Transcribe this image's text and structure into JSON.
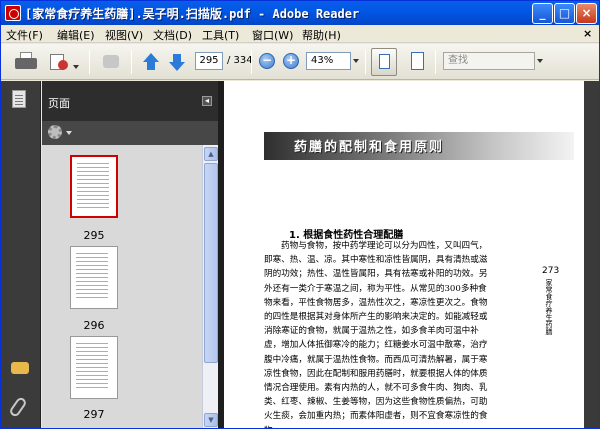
{
  "window": {
    "title": "[家常食疗养生药膳].吴子明.扫描版.pdf - Adobe Reader"
  },
  "menu": {
    "items": [
      "文件(F)",
      "编辑(E)",
      "视图(V)",
      "文档(D)",
      "工具(T)",
      "窗口(W)",
      "帮助(H)"
    ],
    "close_glyph": "×"
  },
  "toolbar": {
    "page_current": "295",
    "page_total": "/ 334",
    "zoom": "43%",
    "search_placeholder": "查找",
    "zoom_out_glyph": "−",
    "zoom_in_glyph": "+"
  },
  "window_buttons": {
    "minimize": "_",
    "maximize": "□",
    "close": "×"
  },
  "panel": {
    "title": "页面",
    "collapse_glyph": "◂",
    "thumbnails": [
      {
        "number": "295",
        "selected": true
      },
      {
        "number": "296",
        "selected": false
      },
      {
        "number": "297",
        "selected": false
      }
    ],
    "scroll_up": "▲",
    "scroll_down": "▼"
  },
  "document": {
    "heading": "药膳的配制和食用原则",
    "section_title": "1. 根据食性药性合理配膳",
    "side_page_number": "273",
    "side_caption": "家常食疗养生药膳",
    "paragraph_lines": [
      "药物与食物，按中药学理论可以分为四性，又叫四气，",
      "即寒、热、温、凉。其中寒性和凉性皆属阴，具有清热或滋",
      "阴的功效；热性、温性皆属阳，具有祛寒或补阳的功效。另",
      "外还有一类介于寒温之间，称为平性。从常见的300多种食",
      "物来看，平性食物居多，温热性次之，寒凉性更次之。食物",
      "的四性是根据其对身体所产生的影响来决定的。如能减轻或",
      "消除寒证的食物，就属于温热之性，如多食羊肉可温中补",
      "虚，增加人体抵御寒冷的能力；红糖姜水可温中散寒，治疗",
      "腹中冷痛，就属于温热性食物。而西瓜可清热解暑，属于寒",
      "凉性食物，因此在配制和服用药膳时，就要根据人体的体质",
      "情况合理使用。素有内热的人，就不可多食牛肉、狗肉、乳",
      "类、红枣、辣椒、生姜等物，因为这些食物性质偏热，可助",
      "火生痰，会加重内热；而素体阳虚者，则不宜食寒凉性的食",
      "物。"
    ]
  }
}
